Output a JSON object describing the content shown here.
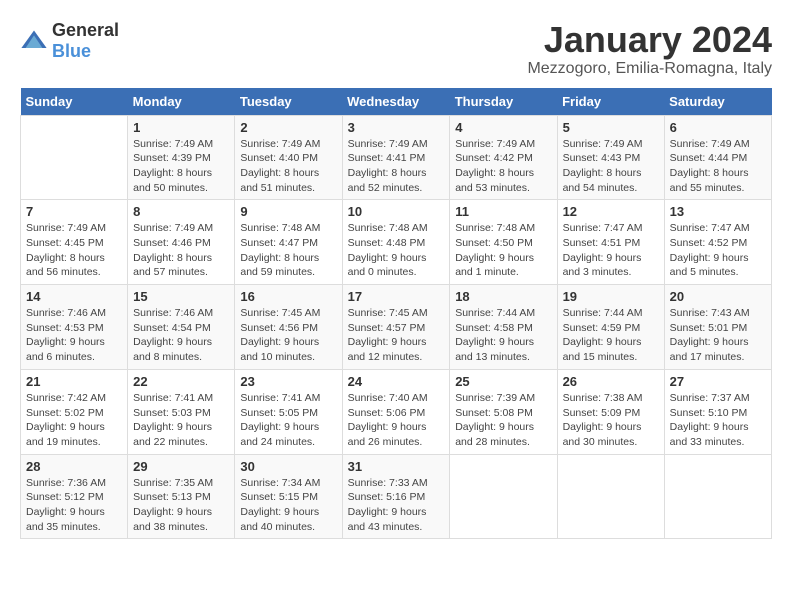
{
  "header": {
    "logo_general": "General",
    "logo_blue": "Blue",
    "month": "January 2024",
    "location": "Mezzogoro, Emilia-Romagna, Italy"
  },
  "columns": [
    "Sunday",
    "Monday",
    "Tuesday",
    "Wednesday",
    "Thursday",
    "Friday",
    "Saturday"
  ],
  "weeks": [
    [
      {
        "day": "",
        "sunrise": "",
        "sunset": "",
        "daylight": ""
      },
      {
        "day": "1",
        "sunrise": "Sunrise: 7:49 AM",
        "sunset": "Sunset: 4:39 PM",
        "daylight": "Daylight: 8 hours and 50 minutes."
      },
      {
        "day": "2",
        "sunrise": "Sunrise: 7:49 AM",
        "sunset": "Sunset: 4:40 PM",
        "daylight": "Daylight: 8 hours and 51 minutes."
      },
      {
        "day": "3",
        "sunrise": "Sunrise: 7:49 AM",
        "sunset": "Sunset: 4:41 PM",
        "daylight": "Daylight: 8 hours and 52 minutes."
      },
      {
        "day": "4",
        "sunrise": "Sunrise: 7:49 AM",
        "sunset": "Sunset: 4:42 PM",
        "daylight": "Daylight: 8 hours and 53 minutes."
      },
      {
        "day": "5",
        "sunrise": "Sunrise: 7:49 AM",
        "sunset": "Sunset: 4:43 PM",
        "daylight": "Daylight: 8 hours and 54 minutes."
      },
      {
        "day": "6",
        "sunrise": "Sunrise: 7:49 AM",
        "sunset": "Sunset: 4:44 PM",
        "daylight": "Daylight: 8 hours and 55 minutes."
      }
    ],
    [
      {
        "day": "7",
        "sunrise": "Sunrise: 7:49 AM",
        "sunset": "Sunset: 4:45 PM",
        "daylight": "Daylight: 8 hours and 56 minutes."
      },
      {
        "day": "8",
        "sunrise": "Sunrise: 7:49 AM",
        "sunset": "Sunset: 4:46 PM",
        "daylight": "Daylight: 8 hours and 57 minutes."
      },
      {
        "day": "9",
        "sunrise": "Sunrise: 7:48 AM",
        "sunset": "Sunset: 4:47 PM",
        "daylight": "Daylight: 8 hours and 59 minutes."
      },
      {
        "day": "10",
        "sunrise": "Sunrise: 7:48 AM",
        "sunset": "Sunset: 4:48 PM",
        "daylight": "Daylight: 9 hours and 0 minutes."
      },
      {
        "day": "11",
        "sunrise": "Sunrise: 7:48 AM",
        "sunset": "Sunset: 4:50 PM",
        "daylight": "Daylight: 9 hours and 1 minute."
      },
      {
        "day": "12",
        "sunrise": "Sunrise: 7:47 AM",
        "sunset": "Sunset: 4:51 PM",
        "daylight": "Daylight: 9 hours and 3 minutes."
      },
      {
        "day": "13",
        "sunrise": "Sunrise: 7:47 AM",
        "sunset": "Sunset: 4:52 PM",
        "daylight": "Daylight: 9 hours and 5 minutes."
      }
    ],
    [
      {
        "day": "14",
        "sunrise": "Sunrise: 7:46 AM",
        "sunset": "Sunset: 4:53 PM",
        "daylight": "Daylight: 9 hours and 6 minutes."
      },
      {
        "day": "15",
        "sunrise": "Sunrise: 7:46 AM",
        "sunset": "Sunset: 4:54 PM",
        "daylight": "Daylight: 9 hours and 8 minutes."
      },
      {
        "day": "16",
        "sunrise": "Sunrise: 7:45 AM",
        "sunset": "Sunset: 4:56 PM",
        "daylight": "Daylight: 9 hours and 10 minutes."
      },
      {
        "day": "17",
        "sunrise": "Sunrise: 7:45 AM",
        "sunset": "Sunset: 4:57 PM",
        "daylight": "Daylight: 9 hours and 12 minutes."
      },
      {
        "day": "18",
        "sunrise": "Sunrise: 7:44 AM",
        "sunset": "Sunset: 4:58 PM",
        "daylight": "Daylight: 9 hours and 13 minutes."
      },
      {
        "day": "19",
        "sunrise": "Sunrise: 7:44 AM",
        "sunset": "Sunset: 4:59 PM",
        "daylight": "Daylight: 9 hours and 15 minutes."
      },
      {
        "day": "20",
        "sunrise": "Sunrise: 7:43 AM",
        "sunset": "Sunset: 5:01 PM",
        "daylight": "Daylight: 9 hours and 17 minutes."
      }
    ],
    [
      {
        "day": "21",
        "sunrise": "Sunrise: 7:42 AM",
        "sunset": "Sunset: 5:02 PM",
        "daylight": "Daylight: 9 hours and 19 minutes."
      },
      {
        "day": "22",
        "sunrise": "Sunrise: 7:41 AM",
        "sunset": "Sunset: 5:03 PM",
        "daylight": "Daylight: 9 hours and 22 minutes."
      },
      {
        "day": "23",
        "sunrise": "Sunrise: 7:41 AM",
        "sunset": "Sunset: 5:05 PM",
        "daylight": "Daylight: 9 hours and 24 minutes."
      },
      {
        "day": "24",
        "sunrise": "Sunrise: 7:40 AM",
        "sunset": "Sunset: 5:06 PM",
        "daylight": "Daylight: 9 hours and 26 minutes."
      },
      {
        "day": "25",
        "sunrise": "Sunrise: 7:39 AM",
        "sunset": "Sunset: 5:08 PM",
        "daylight": "Daylight: 9 hours and 28 minutes."
      },
      {
        "day": "26",
        "sunrise": "Sunrise: 7:38 AM",
        "sunset": "Sunset: 5:09 PM",
        "daylight": "Daylight: 9 hours and 30 minutes."
      },
      {
        "day": "27",
        "sunrise": "Sunrise: 7:37 AM",
        "sunset": "Sunset: 5:10 PM",
        "daylight": "Daylight: 9 hours and 33 minutes."
      }
    ],
    [
      {
        "day": "28",
        "sunrise": "Sunrise: 7:36 AM",
        "sunset": "Sunset: 5:12 PM",
        "daylight": "Daylight: 9 hours and 35 minutes."
      },
      {
        "day": "29",
        "sunrise": "Sunrise: 7:35 AM",
        "sunset": "Sunset: 5:13 PM",
        "daylight": "Daylight: 9 hours and 38 minutes."
      },
      {
        "day": "30",
        "sunrise": "Sunrise: 7:34 AM",
        "sunset": "Sunset: 5:15 PM",
        "daylight": "Daylight: 9 hours and 40 minutes."
      },
      {
        "day": "31",
        "sunrise": "Sunrise: 7:33 AM",
        "sunset": "Sunset: 5:16 PM",
        "daylight": "Daylight: 9 hours and 43 minutes."
      },
      {
        "day": "",
        "sunrise": "",
        "sunset": "",
        "daylight": ""
      },
      {
        "day": "",
        "sunrise": "",
        "sunset": "",
        "daylight": ""
      },
      {
        "day": "",
        "sunrise": "",
        "sunset": "",
        "daylight": ""
      }
    ]
  ]
}
